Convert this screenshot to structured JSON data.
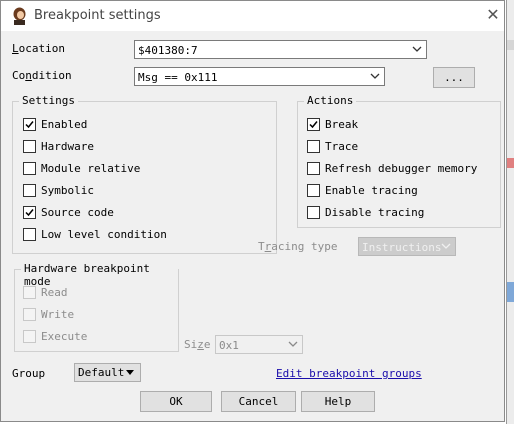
{
  "window": {
    "title": "Breakpoint settings"
  },
  "location": {
    "label": "Location",
    "value": "$401380:7"
  },
  "condition": {
    "label": "Condition",
    "value": "Msg == 0x111",
    "ellipsis": "..."
  },
  "settings": {
    "title": "Settings",
    "items": [
      {
        "label": "Enabled",
        "checked": true
      },
      {
        "label": "Hardware",
        "checked": false
      },
      {
        "label": "Module relative",
        "checked": false
      },
      {
        "label": "Symbolic",
        "checked": false
      },
      {
        "label": "Source code",
        "checked": true
      },
      {
        "label": "Low level condition",
        "checked": false
      }
    ]
  },
  "actions": {
    "title": "Actions",
    "items": [
      {
        "label": "Break",
        "checked": true
      },
      {
        "label": "Trace",
        "checked": false
      },
      {
        "label": "Refresh debugger memory",
        "checked": false
      },
      {
        "label": "Enable tracing",
        "checked": false
      },
      {
        "label": "Disable tracing",
        "checked": false
      }
    ]
  },
  "tracing": {
    "label": "Tracing type",
    "value": "Instructions"
  },
  "hw_mode": {
    "title": "Hardware breakpoint mode",
    "items": [
      {
        "label": "Read"
      },
      {
        "label": "Write"
      },
      {
        "label": "Execute"
      }
    ]
  },
  "size": {
    "label": "Size",
    "value": "0x1"
  },
  "group": {
    "label": "Group",
    "value": "Default"
  },
  "edit_groups": "Edit breakpoint groups",
  "buttons": {
    "ok": "OK",
    "cancel": "Cancel",
    "help": "Help"
  },
  "colors": {
    "check": "#000000",
    "link": "#1a0dab",
    "dialog_bg": "#f0f0f0"
  }
}
